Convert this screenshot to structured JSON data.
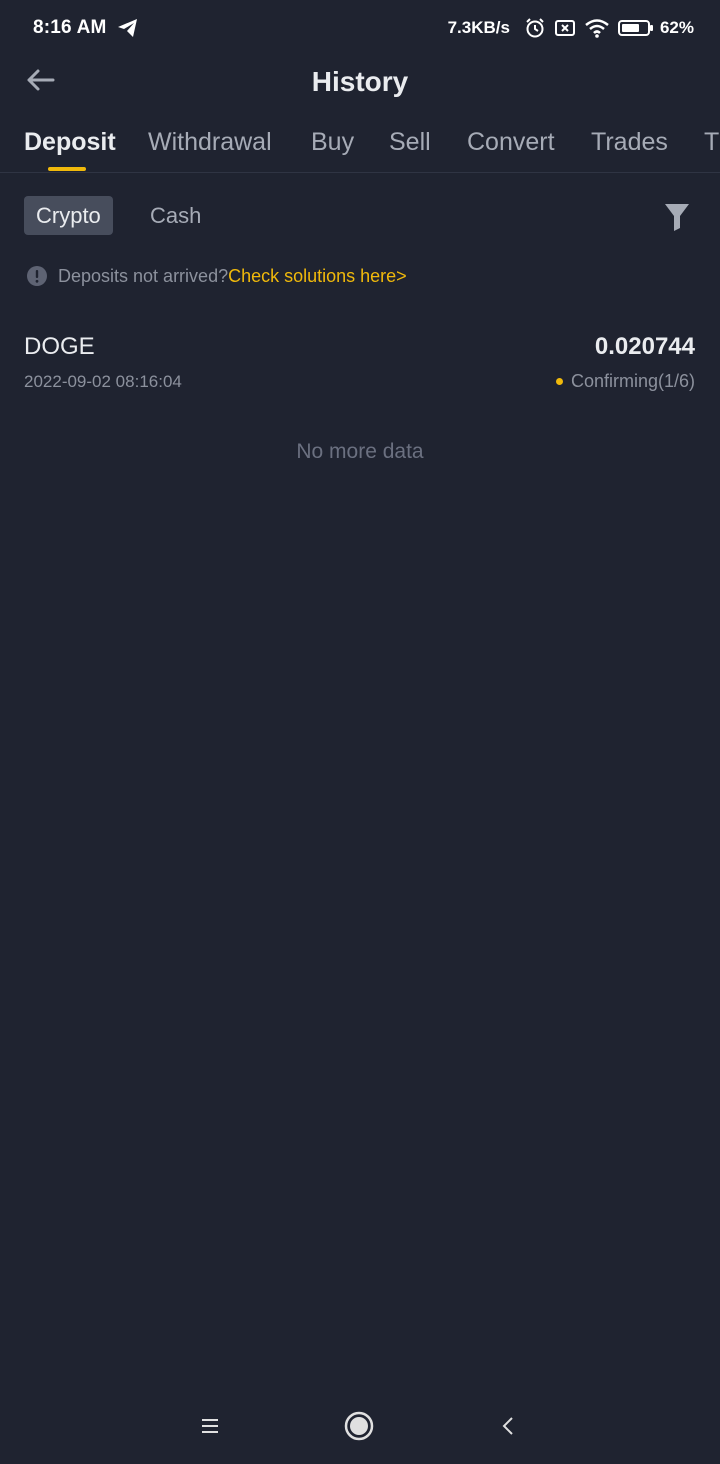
{
  "status_bar": {
    "time": "8:16 AM",
    "net_speed": "7.3KB/s",
    "battery": "62%",
    "icons": [
      "telegram-icon",
      "alarm-icon",
      "sim-icon",
      "wifi-icon",
      "battery-icon"
    ]
  },
  "header": {
    "title": "History",
    "back_icon": "arrow-left-icon"
  },
  "tabs": [
    {
      "label": "Deposit",
      "active": true
    },
    {
      "label": "Withdrawal"
    },
    {
      "label": "Buy"
    },
    {
      "label": "Sell"
    },
    {
      "label": "Convert"
    },
    {
      "label": "Trades"
    },
    {
      "label": "Tr"
    }
  ],
  "subtabs": {
    "crypto": "Crypto",
    "cash": "Cash",
    "filter_icon": "funnel-icon"
  },
  "notice": {
    "text": "Deposits not arrived?",
    "link": "Check solutions here>",
    "icon": "exclamation-circle-icon"
  },
  "records": [
    {
      "asset": "DOGE",
      "amount": "0.020744",
      "time": "2022-09-02 08:16:04",
      "status": "Confirming(1/6)"
    }
  ],
  "footer_text": "No more data",
  "nav": [
    "menu-icon",
    "home-icon",
    "back-icon"
  ],
  "colors": {
    "background": "#1f2330",
    "accent": "#f0b90b",
    "text_primary": "#eaecef",
    "text_secondary": "#8c919d"
  }
}
